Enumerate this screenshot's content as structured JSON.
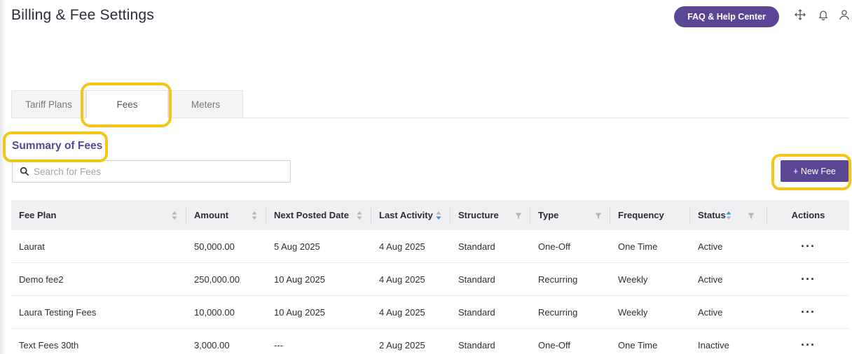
{
  "header": {
    "title": "Billing & Fee Settings",
    "faq_label": "FAQ & Help Center",
    "icons": [
      "move-icon",
      "bell-icon",
      "user-icon"
    ]
  },
  "tabs": [
    {
      "label": "Tariff Plans",
      "active": false
    },
    {
      "label": "Fees",
      "active": true
    },
    {
      "label": "Meters",
      "active": false
    }
  ],
  "section": {
    "title": "Summary of Fees"
  },
  "search": {
    "placeholder": "Search for Fees",
    "value": ""
  },
  "actions": {
    "new_fee_label": "+ New Fee"
  },
  "colors": {
    "accent": "#5b4595",
    "highlight": "#f5c518",
    "sort_active": "#2f8fd8"
  },
  "table": {
    "columns": [
      {
        "label": "Fee Plan",
        "control": "sort"
      },
      {
        "label": "Amount",
        "control": "sort"
      },
      {
        "label": "Next Posted Date",
        "control": "sort"
      },
      {
        "label": "Last Activity",
        "control": "sort-desc-active"
      },
      {
        "label": "Structure",
        "control": "filter"
      },
      {
        "label": "Type",
        "control": "filter"
      },
      {
        "label": "Frequency",
        "control": "none"
      },
      {
        "label": "Status",
        "control": "sort-asc-active+filter"
      },
      {
        "label": "Actions",
        "control": "none"
      }
    ],
    "rows": [
      {
        "fee_plan": "Laurat",
        "amount": "50,000.00",
        "next_posted": "5 Aug 2025",
        "last_activity": "4 Aug 2025",
        "structure": "Standard",
        "type": "One-Off",
        "frequency": "One Time",
        "status": "Active",
        "actions": "···"
      },
      {
        "fee_plan": "Demo fee2",
        "amount": "250,000.00",
        "next_posted": "10 Aug 2025",
        "last_activity": "4 Aug 2025",
        "structure": "Standard",
        "type": "Recurring",
        "frequency": "Weekly",
        "status": "Active",
        "actions": "···"
      },
      {
        "fee_plan": "Laura Testing Fees",
        "amount": "10,000.00",
        "next_posted": "10 Aug 2025",
        "last_activity": "4 Aug 2025",
        "structure": "Standard",
        "type": "Recurring",
        "frequency": "Weekly",
        "status": "Active",
        "actions": "···"
      },
      {
        "fee_plan": "Text Fees 30th",
        "amount": "3,000.00",
        "next_posted": "---",
        "last_activity": "2 Aug 2025",
        "structure": "Standard",
        "type": "One-Off",
        "frequency": "One Time",
        "status": "Inactive",
        "actions": "···"
      }
    ]
  }
}
